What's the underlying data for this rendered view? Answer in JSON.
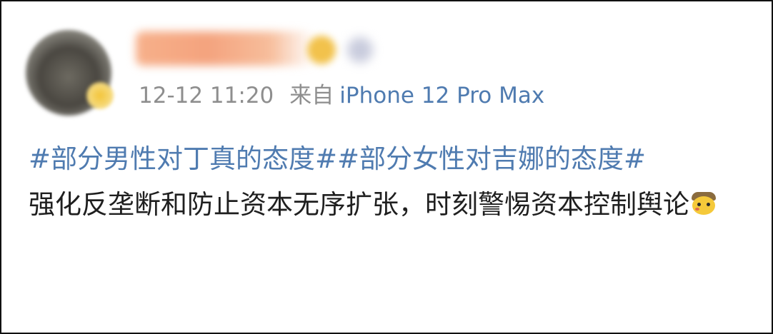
{
  "post": {
    "timestamp": "12-12 11:20",
    "via_label": "来自",
    "device": "iPhone 12 Pro Max",
    "tags_line": "#部分男性对丁真的态度##部分女性对吉娜的态度#",
    "content": "强化反垄断和防止资本无序扩张，时刻警惕资本控制舆论",
    "emoji": "detective-pikachu-emoji"
  },
  "colors": {
    "link_blue": "#4f7bb0",
    "meta_gray": "#8e8e8e",
    "text": "#1f1f1f"
  }
}
